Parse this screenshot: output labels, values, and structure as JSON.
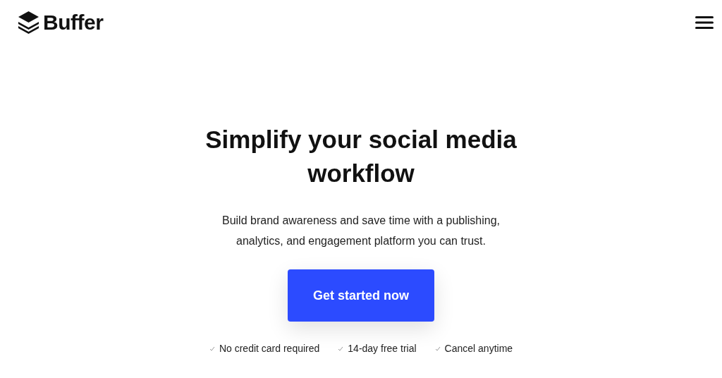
{
  "header": {
    "logo_text": "Buffer"
  },
  "hero": {
    "title": "Simplify your social media workflow",
    "subtitle": "Build brand awareness and save time with a publishing, analytics, and engagement platform you can trust.",
    "cta": "Get started now",
    "features": [
      "No credit card required",
      "14-day free trial",
      "Cancel anytime"
    ]
  }
}
